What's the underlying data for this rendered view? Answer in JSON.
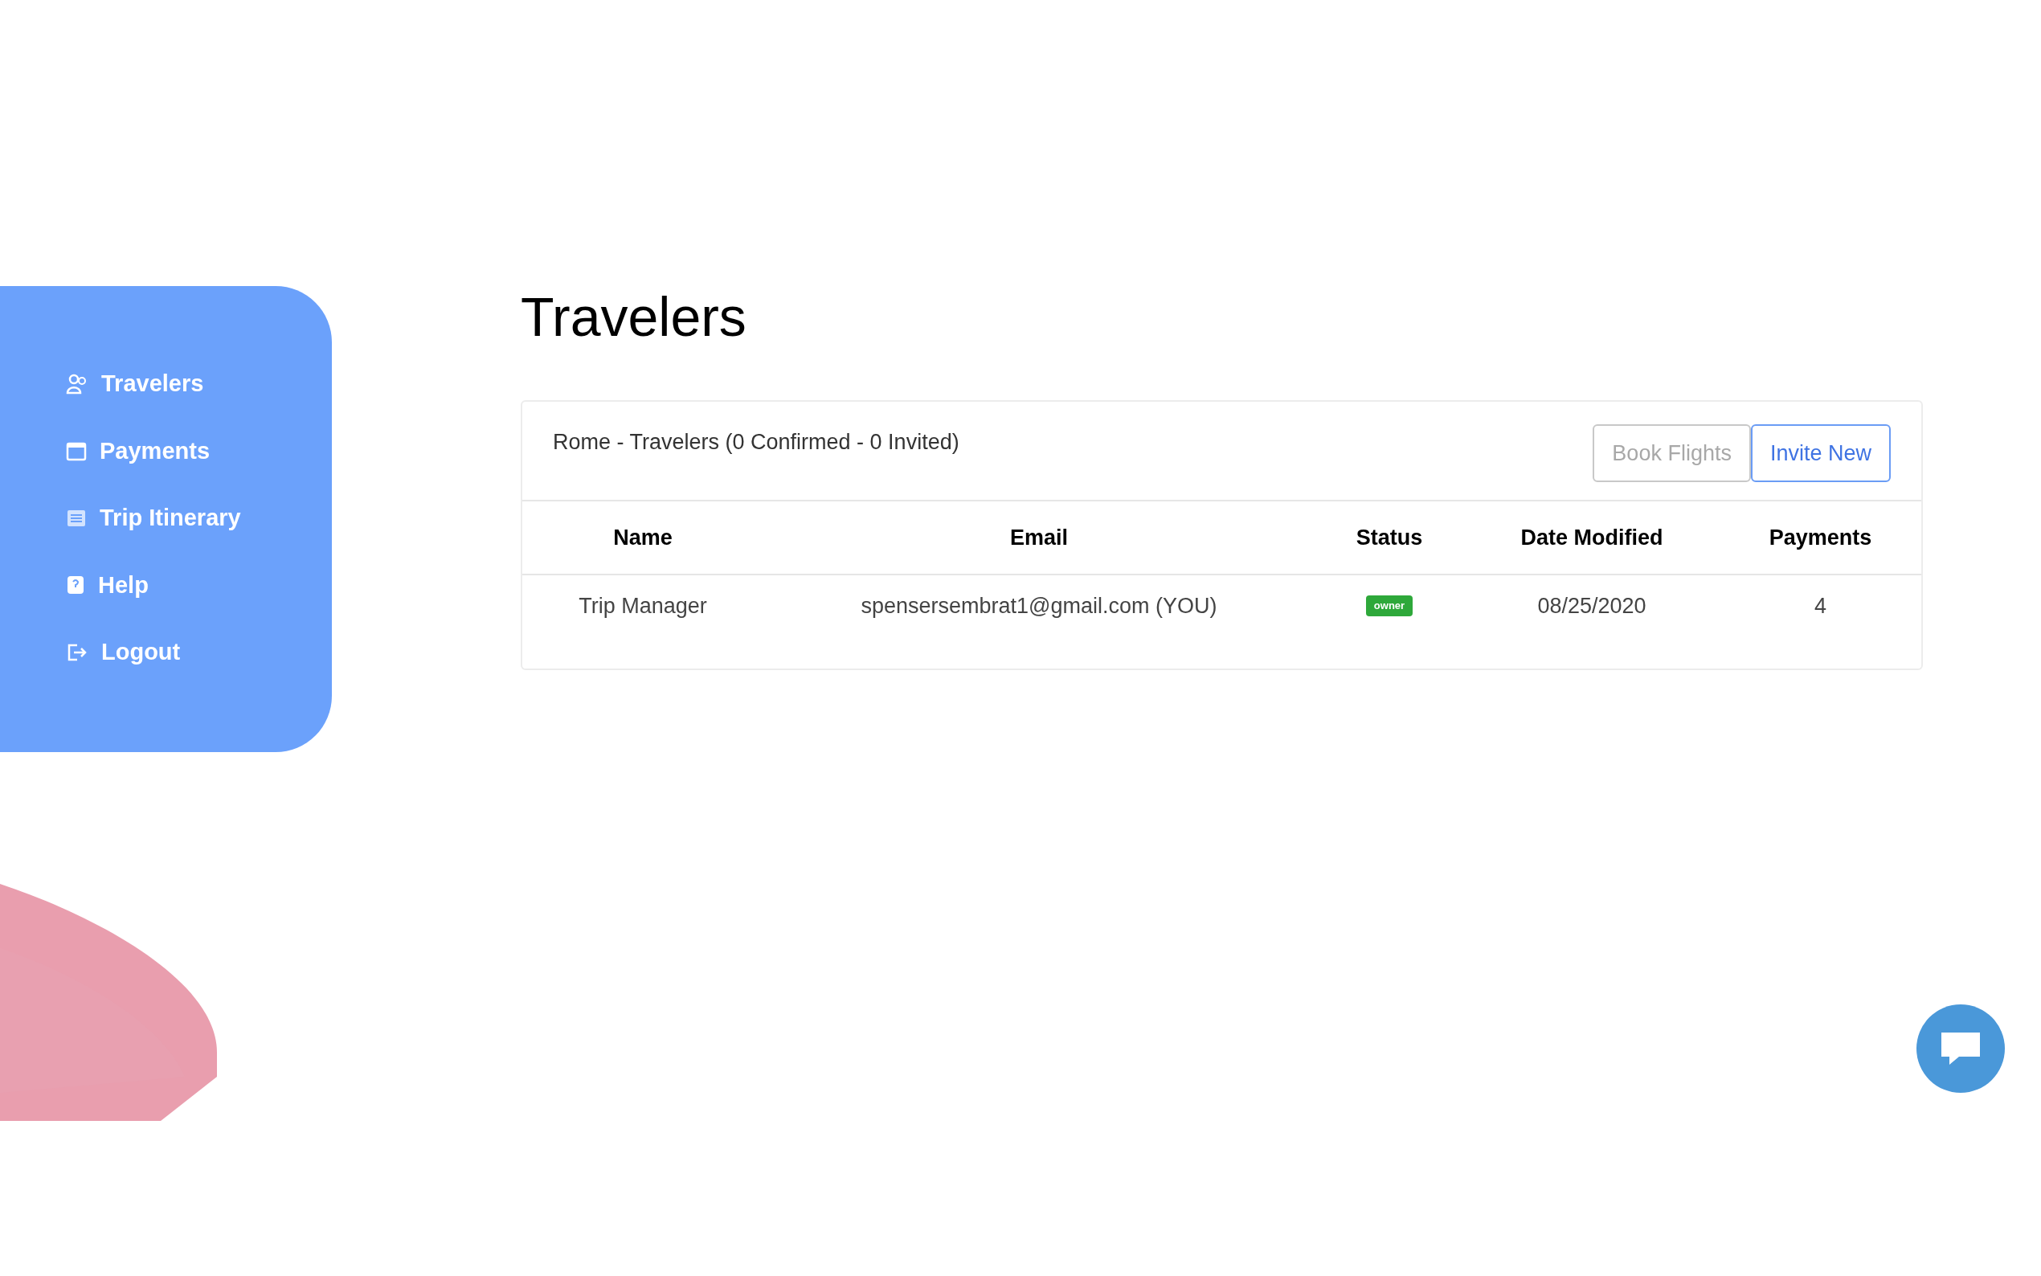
{
  "sidebar": {
    "items": [
      {
        "label": "Travelers"
      },
      {
        "label": "Payments"
      },
      {
        "label": "Trip Itinerary"
      },
      {
        "label": "Help"
      },
      {
        "label": "Logout"
      }
    ]
  },
  "title": "Travelers",
  "card": {
    "heading": "Rome - Travelers (0 Confirmed - 0 Invited)",
    "buttons": [
      {
        "label": "Book Flights",
        "kind": "secondary"
      },
      {
        "label": "Invite New",
        "kind": "primary"
      }
    ],
    "table": {
      "columns": [
        "Name",
        "Email",
        "Status",
        "Date Modified",
        "Payments"
      ],
      "rows": [
        {
          "name": "Trip Manager",
          "email": "spensersembrat1@gmail.com (YOU)",
          "status": "owner",
          "date_modified": "08/25/2020",
          "payments": "4"
        }
      ]
    }
  }
}
